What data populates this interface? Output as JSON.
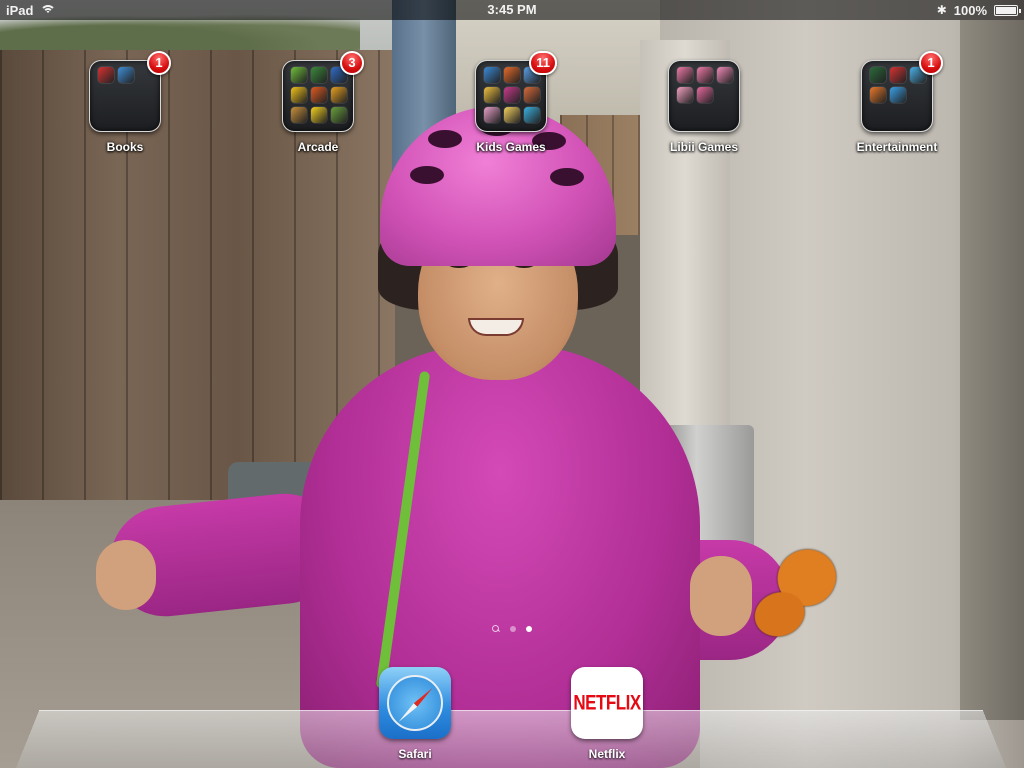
{
  "status_bar": {
    "device": "iPad",
    "time": "3:45 PM",
    "battery": "100%",
    "battery_level": 1.0
  },
  "folders": [
    {
      "label": "Books",
      "badge": "1",
      "icons": [
        "#d83232",
        "#3f8fd8"
      ]
    },
    {
      "label": "Arcade",
      "badge": "3",
      "icons": [
        "#6fbf3a",
        "#3a8a3a",
        "#2e6cc8",
        "#f2c21a",
        "#e05a20",
        "#e8a020",
        "#c8903a",
        "#f4d020",
        "#6aa03a"
      ]
    },
    {
      "label": "Kids Games",
      "badge": "11",
      "icons": [
        "#3a8ad8",
        "#e86a2a",
        "#5aa0e8",
        "#f0c040",
        "#c83a8a",
        "#d86a3a",
        "#e8a0c8",
        "#f4d060",
        "#3ab0e0"
      ]
    },
    {
      "label": "Libii Games",
      "badge": "",
      "icons": [
        "#f07aa8",
        "#f07aa8",
        "#f28ab8",
        "#f4a0c0",
        "#e86aa0"
      ]
    },
    {
      "label": "Entertainment",
      "badge": "1",
      "icons": [
        "#2a6a3a",
        "#d83232",
        "#4ab0e8",
        "#e8782a",
        "#3aa0e8"
      ]
    }
  ],
  "page_dots": {
    "count": 2,
    "active": 2,
    "has_search": true
  },
  "dock": [
    {
      "label": "Safari",
      "icon": "safari-compass-icon"
    },
    {
      "label": "Netflix",
      "icon": "netflix-logo-icon",
      "logo_text": "NETFLIX"
    }
  ]
}
